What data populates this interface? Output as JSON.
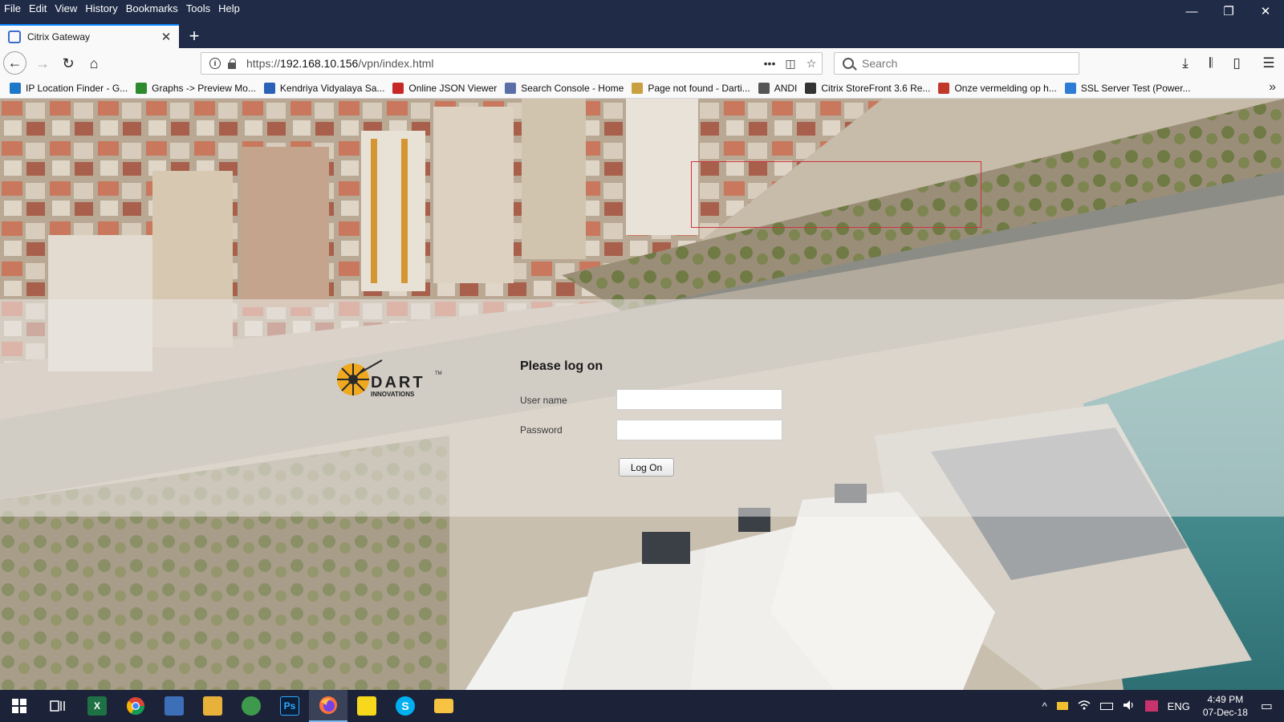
{
  "menu": [
    "File",
    "Edit",
    "View",
    "History",
    "Bookmarks",
    "Tools",
    "Help"
  ],
  "window_controls": {
    "minimize": "—",
    "restore": "❐",
    "close": "✕"
  },
  "tab": {
    "title": "Citrix Gateway",
    "close": "✕",
    "new_tab": "+"
  },
  "nav": {
    "back": "←",
    "forward": "→",
    "reload": "↻",
    "home": "⌂"
  },
  "url": {
    "scheme": "https://",
    "host": "192.168.10.156",
    "path": "/vpn/index.html",
    "info": "i"
  },
  "url_actions": {
    "more": "•••",
    "pocket": "◫",
    "star": "☆"
  },
  "search": {
    "placeholder": "Search"
  },
  "toolbar_right": {
    "downloads": "⤓",
    "library": "𝄃",
    "sidebar": "▯",
    "menu": "☰"
  },
  "bookmarks": [
    {
      "label": "IP Location Finder - G...",
      "icon": "ip-icon",
      "color": "#1e78c8"
    },
    {
      "label": "Graphs -> Preview Mo...",
      "icon": "leaf-icon",
      "color": "#2d8b2d"
    },
    {
      "label": "Kendriya Vidyalaya Sa...",
      "icon": "kv-icon",
      "color": "#2a62b8"
    },
    {
      "label": "Online JSON Viewer",
      "icon": "json-icon",
      "color": "#c62828"
    },
    {
      "label": "Search Console - Home",
      "icon": "console-icon",
      "color": "#5a6fa8"
    },
    {
      "label": "Page not found - Darti...",
      "icon": "dart-icon",
      "color": "#c8a040"
    },
    {
      "label": "ANDI",
      "icon": "globe-icon",
      "color": "#555555"
    },
    {
      "label": "Citrix StoreFront 3.6 Re...",
      "icon": "citrix-icon",
      "color": "#333333"
    },
    {
      "label": "Onze vermelding op h...",
      "icon": "check-icon",
      "color": "#c0392b"
    },
    {
      "label": "SSL Server Test (Power...",
      "icon": "ssl-icon",
      "color": "#2e7bd6"
    }
  ],
  "bookmarks_overflow": "»",
  "login": {
    "title": "Please log on",
    "username_label": "User name",
    "username_value": "",
    "password_label": "Password",
    "password_value": "",
    "submit": "Log On"
  },
  "logo": {
    "name": "DART",
    "sub": "INNOVATIONS",
    "tm": "TM",
    "color": "#e8a21c"
  },
  "taskbar": {
    "apps": [
      "start",
      "task-view",
      "excel",
      "chrome",
      "network-tool",
      "outlook",
      "green-app",
      "photoshop",
      "firefox",
      "sticky-notes",
      "skype",
      "file-explorer"
    ],
    "ps_label": "Ps",
    "skype_label": "S",
    "excel_label": "X"
  },
  "tray": {
    "chevron": "^",
    "lang": "ENG",
    "time": "4:49 PM",
    "date": "07-Dec-18",
    "notification": "▭"
  }
}
